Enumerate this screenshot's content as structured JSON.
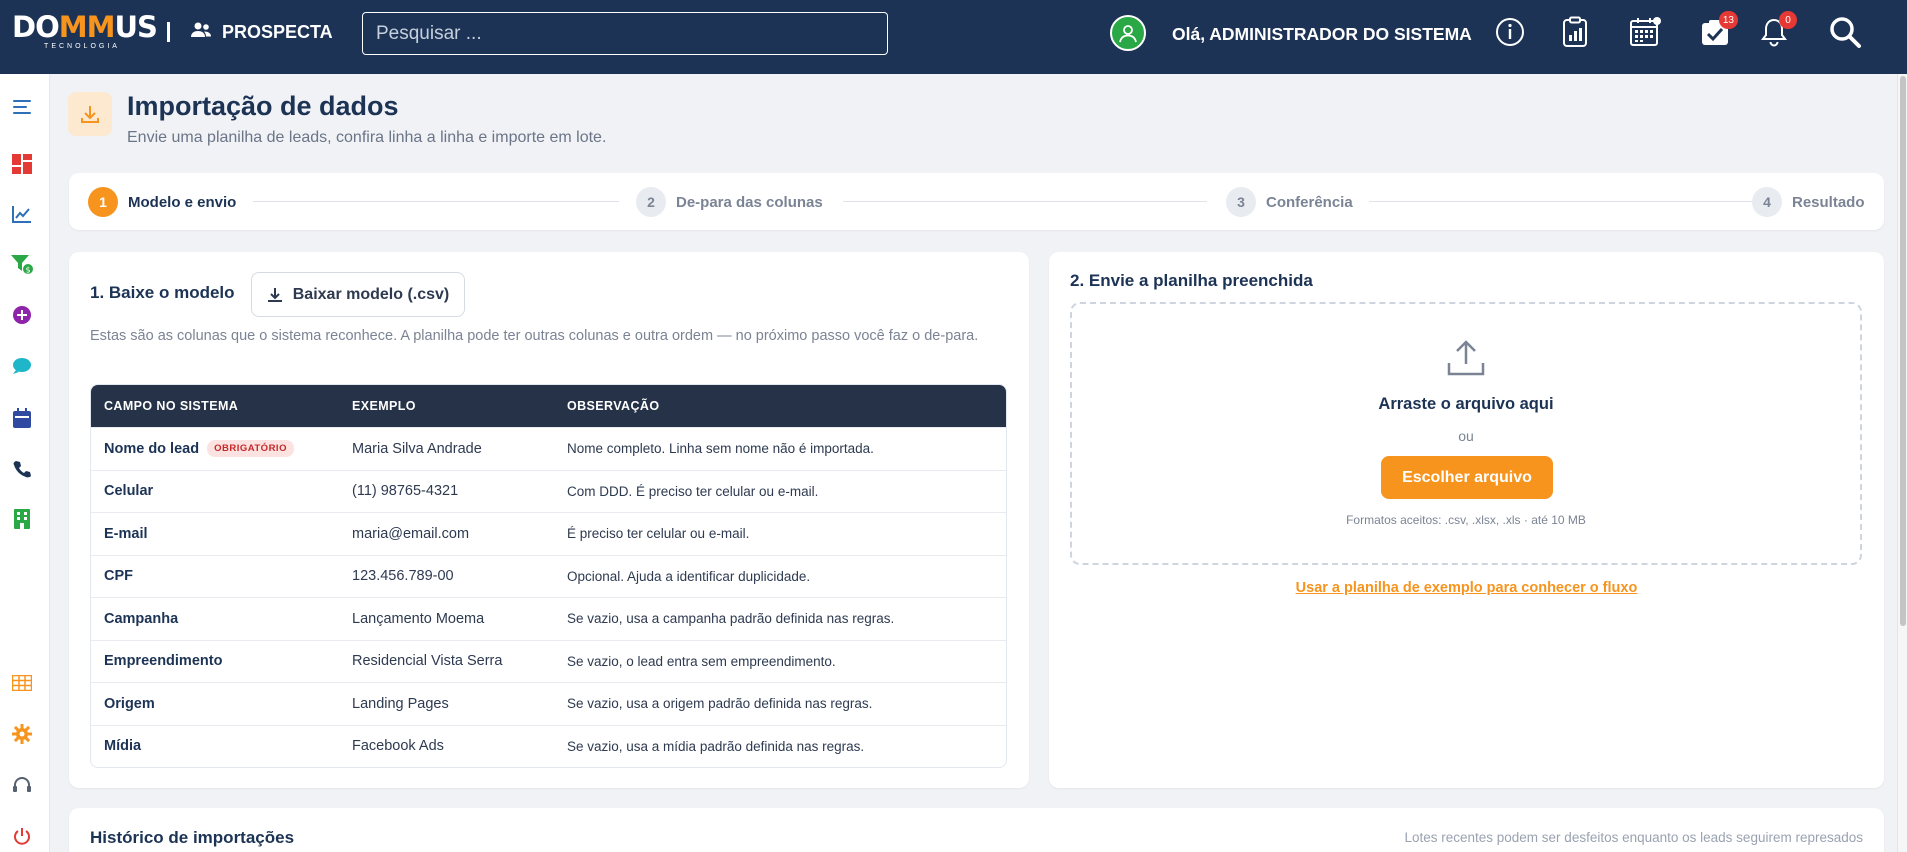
{
  "topbar": {
    "logo_text_a": "DO",
    "logo_text_m": "MM",
    "logo_text_b": "US",
    "logo_sub": "TECNOLOGIA",
    "module_name": "PROSPECTA",
    "search_placeholder": "Pesquisar ...",
    "greeting": "Olá, ADMINISTRADOR DO SISTEMA",
    "tasks_badge": "13",
    "notifications_badge": "0"
  },
  "header": {
    "title": "Importação de dados",
    "subtitle": "Envie uma planilha de leads, confira linha a linha e importe em lote."
  },
  "stepper": [
    {
      "num": "1",
      "label": "Modelo e envio"
    },
    {
      "num": "2",
      "label": "De-para das colunas"
    },
    {
      "num": "3",
      "label": "Conferência"
    },
    {
      "num": "4",
      "label": "Resultado"
    }
  ],
  "template_section": {
    "title": "1. Baixe o modelo",
    "download_label": "Baixar modelo (.csv)",
    "description": "Estas são as colunas que o sistema reconhece. A planilha pode ter outras colunas e outra ordem — no próximo passo você faz o de-para.",
    "columns": [
      "CAMPO NO SISTEMA",
      "EXEMPLO",
      "OBSERVAÇÃO"
    ],
    "required_label": "OBRIGATÓRIO",
    "rows": [
      {
        "field": "Nome do lead",
        "example": "Maria Silva Andrade",
        "note": "Nome completo. Linha sem nome não é importada.",
        "required": true
      },
      {
        "field": "Celular",
        "example": "(11) 98765-4321",
        "note": "Com DDD. É preciso ter celular ou e-mail."
      },
      {
        "field": "E-mail",
        "example": "maria@email.com",
        "note": "É preciso ter celular ou e-mail."
      },
      {
        "field": "CPF",
        "example": "123.456.789-00",
        "note": "Opcional. Ajuda a identificar duplicidade."
      },
      {
        "field": "Campanha",
        "example": "Lançamento Moema",
        "note": "Se vazio, usa a campanha padrão definida nas regras."
      },
      {
        "field": "Empreendimento",
        "example": "Residencial Vista Serra",
        "note": "Se vazio, o lead entra sem empreendimento."
      },
      {
        "field": "Origem",
        "example": "Landing Pages",
        "note": "Se vazio, usa a origem padrão definida nas regras."
      },
      {
        "field": "Mídia",
        "example": "Facebook Ads",
        "note": "Se vazio, usa a mídia padrão definida nas regras."
      }
    ]
  },
  "upload_section": {
    "title": "2. Envie a planilha preenchida",
    "drop_title": "Arraste o arquivo aqui",
    "or": "ou",
    "choose_label": "Escolher arquivo",
    "formats": "Formatos aceitos: .csv, .xlsx, .xls · até 10 MB",
    "sample_link": "Usar a planilha de exemplo para conhecer o fluxo"
  },
  "history": {
    "title": "Histórico de importações",
    "note": "Lotes recentes podem ser desfeitos enquanto os leads seguirem represados"
  },
  "colors": {
    "navy": "#1c3355",
    "accent": "#f7941d",
    "table_header": "#253247",
    "badge_red": "#e53935"
  }
}
